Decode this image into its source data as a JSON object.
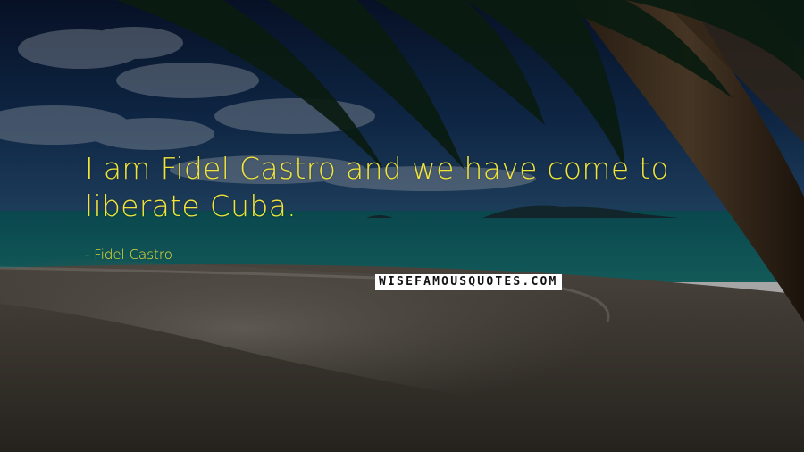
{
  "quote": {
    "text": "I am Fidel Castro and we have come to liberate Cuba.",
    "author": "- Fidel Castro"
  },
  "watermark": {
    "text": "WISEFAMOUSQUOTES.COM"
  },
  "colors": {
    "quote_text": "#f2e53a",
    "watermark_bg": "#ffffff",
    "watermark_text": "#111111"
  },
  "background": {
    "scene": "tropical-beach-with-palm-trees"
  }
}
